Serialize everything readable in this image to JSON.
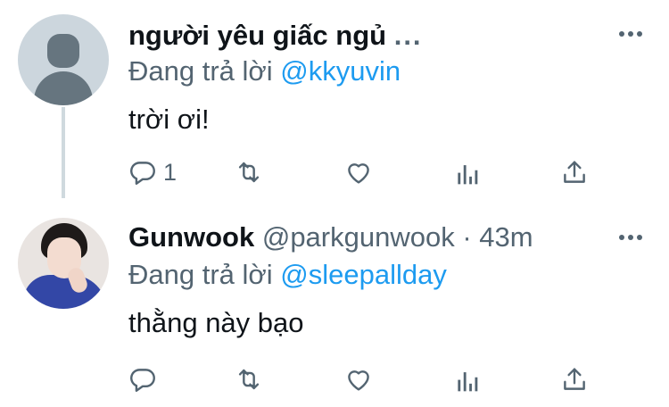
{
  "tweets": [
    {
      "display_name": "người yêu giấc ngủ",
      "name_truncation": "...",
      "handle": "",
      "time": "",
      "reply_prefix": "Đang trả lời",
      "reply_to": "@kkyuvin",
      "text": "trời ơi!",
      "reply_count": "1",
      "avatar": "default-avatar"
    },
    {
      "display_name": "Gunwook",
      "name_truncation": "",
      "handle": "@parkgunwook",
      "separator": "·",
      "time": "43m",
      "reply_prefix": "Đang trả lời",
      "reply_to": "@sleepallday",
      "text": "thằng này bạo",
      "reply_count": "",
      "avatar": "profile-photo"
    }
  ],
  "icons": {
    "reply": "reply-icon",
    "retweet": "retweet-icon",
    "like": "heart-icon",
    "analytics": "analytics-icon",
    "share": "share-icon",
    "more": "more-icon"
  },
  "colors": {
    "link": "#1d9bf0",
    "secondary_text": "#536471",
    "primary_text": "#0f1419",
    "thread_line": "#cfd9de"
  }
}
